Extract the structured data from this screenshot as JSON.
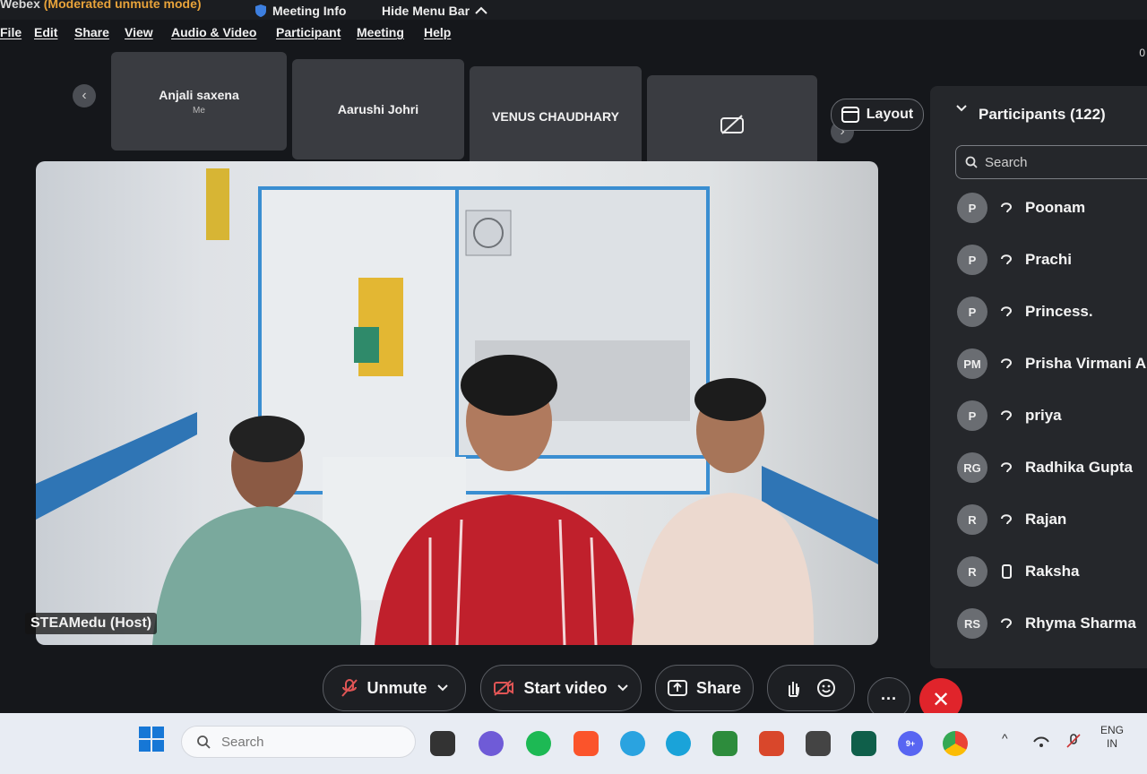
{
  "titlebar": {
    "app": "Webex",
    "mode": "(Moderated unmute mode)",
    "meeting_info": "Meeting Info",
    "hide_menu": "Hide Menu Bar"
  },
  "menu": [
    "File",
    "Edit",
    "Share",
    "View",
    "Audio & Video",
    "Participant",
    "Meeting",
    "Help"
  ],
  "corner_number": "0",
  "thumbnails": [
    {
      "name": "Anjali saxena",
      "sub": "Me"
    },
    {
      "name": "Aarushi Johri"
    },
    {
      "name": "VENUS CHAUDHARY"
    },
    {
      "name": ""
    }
  ],
  "layout_label": "Layout",
  "video": {
    "host_label": "STEAMedu (Host)"
  },
  "controls": {
    "unmute": "Unmute",
    "start_video": "Start video",
    "share": "Share",
    "more": "···"
  },
  "participants": {
    "title": "Participants (122)",
    "search_placeholder": "Search",
    "list": [
      {
        "initials": "P",
        "name": "Poonam",
        "device": "audio"
      },
      {
        "initials": "P",
        "name": "Prachi",
        "device": "audio"
      },
      {
        "initials": "P",
        "name": "Princess.",
        "device": "audio"
      },
      {
        "initials": "PM",
        "name": "Prisha Virmani AI",
        "device": "audio"
      },
      {
        "initials": "P",
        "name": "priya",
        "device": "audio"
      },
      {
        "initials": "RG",
        "name": "Radhika Gupta",
        "device": "audio"
      },
      {
        "initials": "R",
        "name": "Rajan",
        "device": "audio"
      },
      {
        "initials": "R",
        "name": "Raksha",
        "device": "phone"
      },
      {
        "initials": "RS",
        "name": "Rhyma Sharma",
        "device": "audio"
      }
    ]
  },
  "taskbar": {
    "search_placeholder": "Search",
    "lang_top": "ENG",
    "lang_bottom": "IN",
    "discord_badge": "9+"
  },
  "colors": {
    "accent_orange": "#e8a33a",
    "end_red": "#e0242b",
    "panel": "#25272b"
  }
}
